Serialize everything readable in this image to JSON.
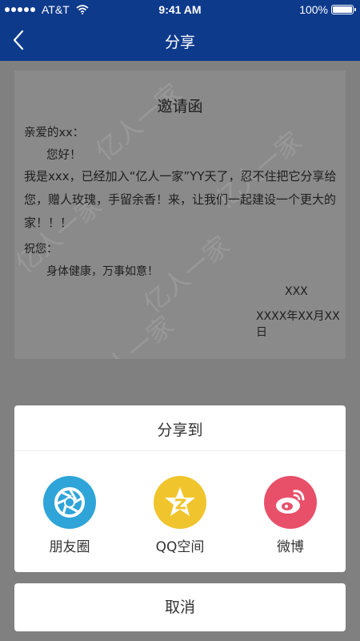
{
  "status_bar": {
    "carrier": "AT&T",
    "time": "9:41 AM",
    "battery": "100%",
    "battery_level": 1.0
  },
  "nav": {
    "title": "分享",
    "back_icon": "chevron-left-icon"
  },
  "letter": {
    "title": "邀请函",
    "salutation": "亲爱的xx：",
    "greeting": "您好！",
    "body": "我是xxx，已经加入“亿人一家”YY天了，忍不住把它分享给您，赠人玫瑰，手留余香！来，让我们一起建设一个更大的家！！！",
    "wish_label": "祝您：",
    "wish": "身体健康，万事如意！",
    "signature": "XXX",
    "date": "XXXX年XX月XX日",
    "watermark": "亿人一家"
  },
  "share_sheet": {
    "title": "分享到",
    "items": [
      {
        "label": "朋友圈",
        "icon": "moments-icon",
        "color": "#2fa4d8"
      },
      {
        "label": "QQ空间",
        "icon": "qzone-icon",
        "color": "#f0c42c"
      },
      {
        "label": "微博",
        "icon": "weibo-icon",
        "color": "#e8506a"
      }
    ],
    "cancel": "取消"
  },
  "colors": {
    "brand": "#0e3a8c",
    "overlay": "#808080"
  }
}
